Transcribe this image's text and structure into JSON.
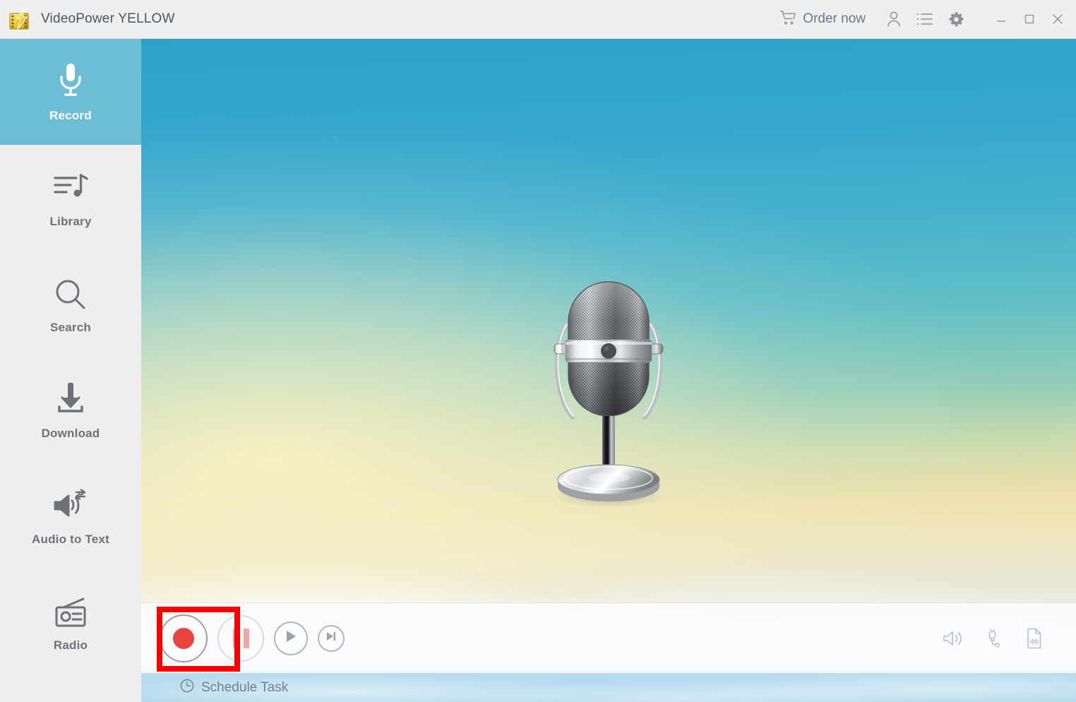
{
  "window": {
    "title": "VideoPower YELLOW",
    "logo_icon": "lightning-filmstrip-logo",
    "minimize_label": "–",
    "maximize_label": "□",
    "close_label": "✕"
  },
  "titlebar": {
    "order_now_label": "Order now",
    "cart_icon": "shopping-cart-icon",
    "account_icon": "user-account-icon",
    "tasklist_icon": "list-icon",
    "settings_icon": "gear-icon"
  },
  "sidebar": {
    "active_color": "#6dbdd5",
    "items": [
      {
        "label": "Record",
        "icon": "microphone-icon",
        "active": true
      },
      {
        "label": "Library",
        "icon": "music-library-icon",
        "active": false
      },
      {
        "label": "Search",
        "icon": "search-icon",
        "active": false
      },
      {
        "label": "Download",
        "icon": "download-icon",
        "active": false
      },
      {
        "label": "Audio to Text",
        "icon": "audio-to-text-icon",
        "active": false
      },
      {
        "label": "Radio",
        "icon": "radio-icon",
        "active": false
      }
    ]
  },
  "stage": {
    "artwork": "vintage-condenser-microphone",
    "background": "sky-gradient-with-clouds",
    "gradient_top": "#2da2c9",
    "gradient_mid": "#efe3b4",
    "gradient_bottom": "#bcdcee"
  },
  "controls": {
    "record": {
      "name": "record-button",
      "icon": "record-dot-icon",
      "color": "#e8443f",
      "highlighted": true
    },
    "pause": {
      "name": "pause-button",
      "icon": "pause-icon",
      "color": "#f0a5a3",
      "disabled": true
    },
    "play": {
      "name": "play-button",
      "icon": "play-icon",
      "color": "#9aa2a8"
    },
    "next": {
      "name": "next-button",
      "icon": "skip-next-icon",
      "color": "#9aa2a8"
    },
    "right_icons": [
      {
        "name": "volume-icon",
        "icon": "speaker-volume-icon"
      },
      {
        "name": "audio-input-icon",
        "icon": "audio-jack-plug-icon"
      },
      {
        "name": "audio-file-icon",
        "icon": "waveform-document-icon"
      }
    ],
    "highlight_color": "#fb0000"
  },
  "footer": {
    "schedule_task_label": "Schedule Task",
    "clock_icon": "clock-icon"
  }
}
